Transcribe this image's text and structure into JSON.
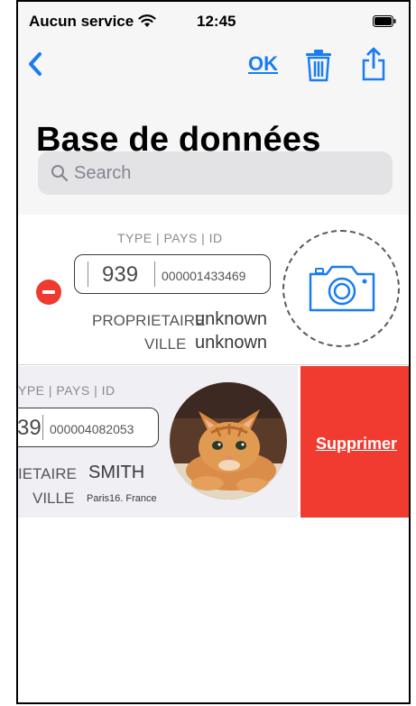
{
  "status_bar": {
    "carrier": "Aucun service",
    "time": "12:45"
  },
  "nav": {
    "ok_label": "OK"
  },
  "title": "Base de données",
  "search": {
    "placeholder": "Search"
  },
  "records": [
    {
      "header": "TYPE | PAYS | ID",
      "code": "939",
      "id": "000001433469",
      "owner_label": "PROPRIETAIRE",
      "owner": "unknown",
      "city_label": "VILLE",
      "city": "unknown"
    },
    {
      "header": "YPE | PAYS | ID",
      "code": "39",
      "id": "000004082053",
      "owner_label": "IETAIRE",
      "owner": "SMITH",
      "city_label": "VILLE",
      "city": "Paris16. France"
    }
  ],
  "delete_label": "Supprimer",
  "colors": {
    "accent": "#1a7cf2",
    "delete": "#f23b30",
    "minus": "#ee3a2f"
  }
}
